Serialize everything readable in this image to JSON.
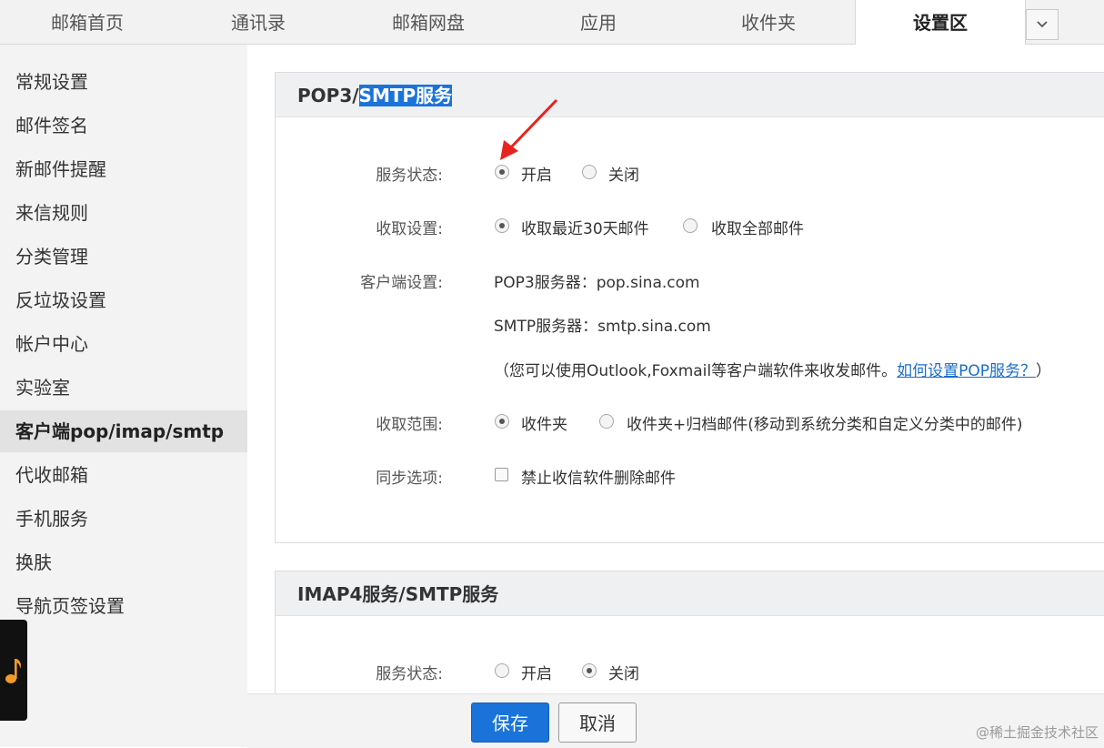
{
  "tabs": [
    {
      "label": "邮箱首页"
    },
    {
      "label": "通讯录"
    },
    {
      "label": "邮箱网盘"
    },
    {
      "label": "应用"
    },
    {
      "label": "收件夹"
    },
    {
      "label": "设置区"
    }
  ],
  "sidebar": {
    "items": [
      {
        "label": "常规设置"
      },
      {
        "label": "邮件签名"
      },
      {
        "label": "新邮件提醒"
      },
      {
        "label": "来信规则"
      },
      {
        "label": "分类管理"
      },
      {
        "label": "反垃圾设置"
      },
      {
        "label": "帐户中心"
      },
      {
        "label": "实验室"
      },
      {
        "label": "客户端pop/imap/smtp"
      },
      {
        "label": "代收邮箱"
      },
      {
        "label": "手机服务"
      },
      {
        "label": "换肤"
      },
      {
        "label": "导航页签设置"
      }
    ],
    "active_index": 8
  },
  "pop3": {
    "title_prefix": "POP3/",
    "title_selected": "SMTP服务",
    "service_status": {
      "label": "服务状态:",
      "option_on": "开启",
      "option_off": "关闭",
      "selected": "on"
    },
    "fetch_setting": {
      "label": "收取设置:",
      "option_30": "收取最近30天邮件",
      "option_all": "收取全部邮件",
      "selected": "30"
    },
    "client_setting": {
      "label": "客户端设置:",
      "pop3_server": "POP3服务器：pop.sina.com",
      "smtp_server": "SMTP服务器：smtp.sina.com",
      "note_open": "（您可以使用Outlook,Foxmail等客户端软件来收发邮件。",
      "note_link": "如何设置POP服务？",
      "note_close": "）"
    },
    "fetch_scope": {
      "label": "收取范围:",
      "option_inbox": "收件夹",
      "option_archive": "收件夹+归档邮件(移动到系统分类和自定义分类中的邮件)",
      "selected": "inbox"
    },
    "sync_option": {
      "label": "同步选项:",
      "checkbox_label": "禁止收信软件删除邮件",
      "checked": false
    }
  },
  "imap": {
    "title": "IMAP4服务/SMTP服务",
    "service_status": {
      "label": "服务状态:",
      "option_on": "开启",
      "option_off": "关闭",
      "selected": "off"
    }
  },
  "footer": {
    "save_label": "保存",
    "cancel_label": "取消"
  },
  "watermark": "@稀土掘金技术社区",
  "colors": {
    "accent": "#1a73d9",
    "annotation_arrow": "#e8231d"
  }
}
